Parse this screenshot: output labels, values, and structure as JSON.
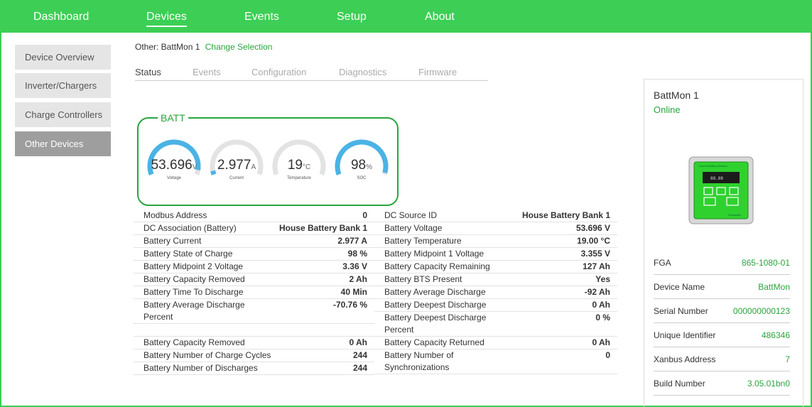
{
  "nav": {
    "items": [
      "Dashboard",
      "Devices",
      "Events",
      "Setup",
      "About"
    ],
    "active": "Devices"
  },
  "sidebar": {
    "items": [
      "Device Overview",
      "Inverter/Chargers",
      "Charge Controllers",
      "Other Devices"
    ],
    "active": "Other Devices"
  },
  "breadcrumb": {
    "prefix": "Other: BattMon 1",
    "change_link": "Change Selection"
  },
  "tabs": {
    "items": [
      "Status",
      "Events",
      "Configuration",
      "Diagnostics",
      "Firmware"
    ],
    "active": "Status"
  },
  "batt": {
    "title": "BATT",
    "gauges": [
      {
        "value": "53.696",
        "unit": "V",
        "label": "Voltage",
        "fraction": 0.95
      },
      {
        "value": "2.977",
        "unit": "A",
        "label": "Current",
        "fraction": 0.04
      },
      {
        "value": "19",
        "unit": "°C",
        "label": "Temperature",
        "fraction": 0.0
      },
      {
        "value": "98",
        "unit": "%",
        "label": "SOC",
        "fraction": 0.98
      }
    ]
  },
  "table_left": [
    {
      "k": "Modbus Address",
      "v": "0"
    },
    {
      "k": "DC Association (Battery)",
      "v": "House Battery Bank 1"
    },
    {
      "k": "Battery Current",
      "v": "2.977 A"
    },
    {
      "k": "Battery State of Charge",
      "v": "98 %"
    },
    {
      "k": "Battery Midpoint 2 Voltage",
      "v": "3.36 V"
    },
    {
      "k": "Battery Capacity Removed",
      "v": "2 Ah"
    },
    {
      "k": "Battery Time To Discharge",
      "v": "40 Min"
    },
    {
      "k": "Battery Average Discharge Percent",
      "v": "-70.76 %"
    },
    {
      "k": "",
      "v": ""
    },
    {
      "k": "Battery Capacity Removed",
      "v": "0 Ah"
    },
    {
      "k": "Battery Number of Charge Cycles",
      "v": "244"
    },
    {
      "k": "Battery Number of Discharges",
      "v": "244"
    }
  ],
  "table_right": [
    {
      "k": "DC Source ID",
      "v": "House Battery Bank 1"
    },
    {
      "k": "Battery Voltage",
      "v": "53.696 V"
    },
    {
      "k": "Battery Temperature",
      "v": "19.00 °C"
    },
    {
      "k": "Battery Midpoint 1 Voltage",
      "v": "3.355 V"
    },
    {
      "k": "Battery Capacity Remaining",
      "v": "127 Ah"
    },
    {
      "k": "Battery BTS Present",
      "v": "Yes"
    },
    {
      "k": "Battery Average Discharge",
      "v": "-92 Ah"
    },
    {
      "k": "Battery Deepest Discharge",
      "v": "0 Ah"
    },
    {
      "k": "Battery Deepest Discharge Percent",
      "v": "0 %"
    },
    {
      "k": "Battery Capacity Returned",
      "v": "0 Ah"
    },
    {
      "k": "Battery Number of Synchronizations",
      "v": "0"
    }
  ],
  "panel": {
    "device_name": "BattMon 1",
    "status": "Online",
    "device_image_title": "Conext Battery Monitor",
    "device_image_screen": "88.88",
    "device_image_brand": "Schneider",
    "rows": [
      {
        "k": "FGA",
        "v": "865-1080-01"
      },
      {
        "k": "Device Name",
        "v": "BattMon"
      },
      {
        "k": "Serial Number",
        "v": "000000000123"
      },
      {
        "k": "Unique Identifier",
        "v": "486346"
      },
      {
        "k": "Xanbus Address",
        "v": "7"
      },
      {
        "k": "Build Number",
        "v": "3.05.01bn0"
      }
    ]
  },
  "colors": {
    "accent": "#3dcf55",
    "link": "#2aa53c",
    "gauge_fill": "#4ab3e6",
    "gauge_track": "#e3e3e3"
  }
}
